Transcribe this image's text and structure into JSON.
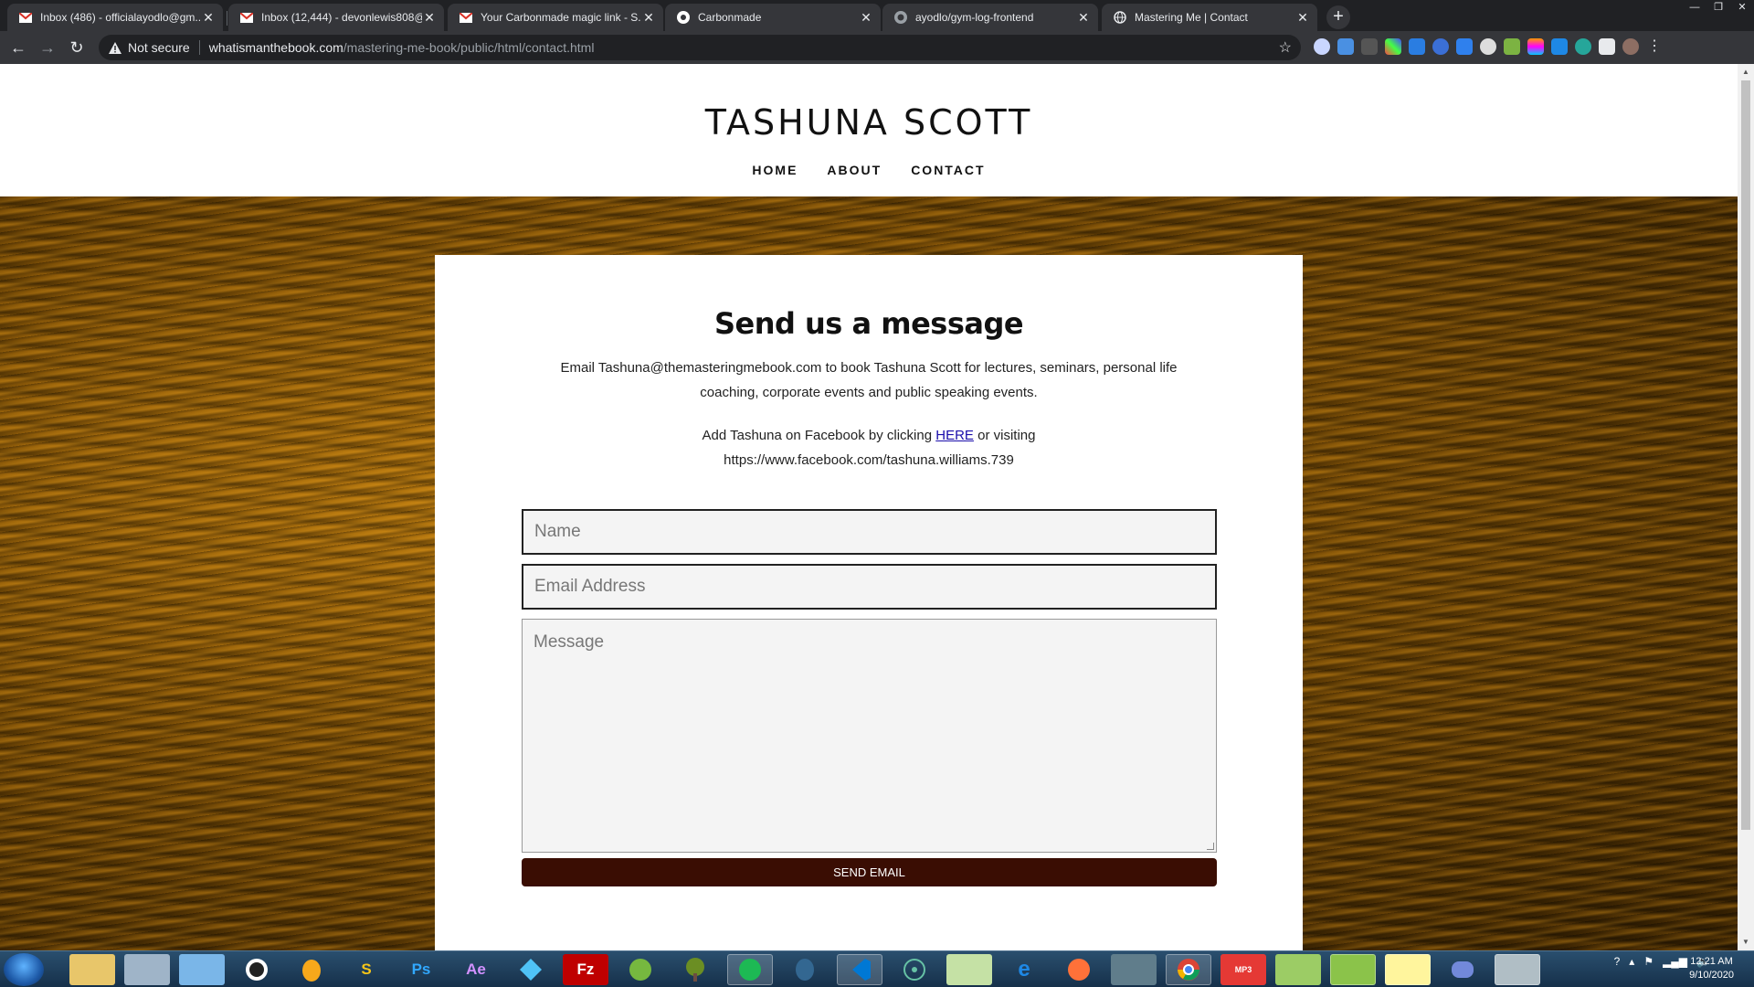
{
  "browser": {
    "tabs": [
      {
        "title": "Inbox (486) - officialayodlo@gm...",
        "icon": "gmail-icon",
        "color": "#d93025"
      },
      {
        "title": "Inbox (12,444) - devonlewis808@...",
        "icon": "gmail-icon",
        "color": "#d93025"
      },
      {
        "title": "Your Carbonmade magic link - S...",
        "icon": "gmail-icon",
        "color": "#d93025"
      },
      {
        "title": "Carbonmade",
        "icon": "carbonmade-icon",
        "color": "#ffffff"
      },
      {
        "title": "ayodlo/gym-log-frontend",
        "icon": "github-icon",
        "color": "#9aa0a6"
      },
      {
        "title": "Mastering Me | Contact",
        "icon": "globe-icon",
        "color": "#e8eaed"
      }
    ],
    "security_label": "Not secure",
    "url_host": "whatismanthebook.com",
    "url_path": "/mastering-me-book/public/html/contact.html"
  },
  "site": {
    "title": "TASHUNA SCOTT",
    "nav": [
      "HOME",
      "ABOUT",
      "CONTACT"
    ]
  },
  "contact": {
    "heading": "Send us a message",
    "email_text": "Email Tashuna@themasteringmebook.com to book Tashuna Scott for lectures, seminars, personal life coaching, corporate events and public speaking events.",
    "fb_prefix": "Add Tashuna on Facebook by clicking",
    "fb_link_label": "HERE",
    "fb_suffix": "or visiting",
    "fb_url": "https://www.facebook.com/tashuna.williams.739",
    "name_placeholder": "Name",
    "email_placeholder": "Email Address",
    "message_placeholder": "Message",
    "send_label": "SEND EMAIL"
  },
  "taskbar": {
    "apps": [
      "file-explorer-icon",
      "calculator-icon",
      "notes-icon",
      "sourcetree-icon",
      "fl-studio-icon",
      "sublime-icon",
      "photoshop-icon",
      "after-effects-icon",
      "gitkraken-icon",
      "filezilla-icon",
      "utorrent-icon",
      "tree-app-icon",
      "spotify-icon",
      "postgres-icon",
      "vscode-icon",
      "atom-icon",
      "chart-app-icon",
      "ie-icon",
      "firefox-icon",
      "terminal-icon",
      "chrome-icon",
      "mp3-icon",
      "notepad-icon",
      "bluestacks-icon",
      "folder-icon",
      "discord-icon",
      "paint-icon"
    ],
    "time": "12:21 AM",
    "date": "9/10/2020"
  }
}
